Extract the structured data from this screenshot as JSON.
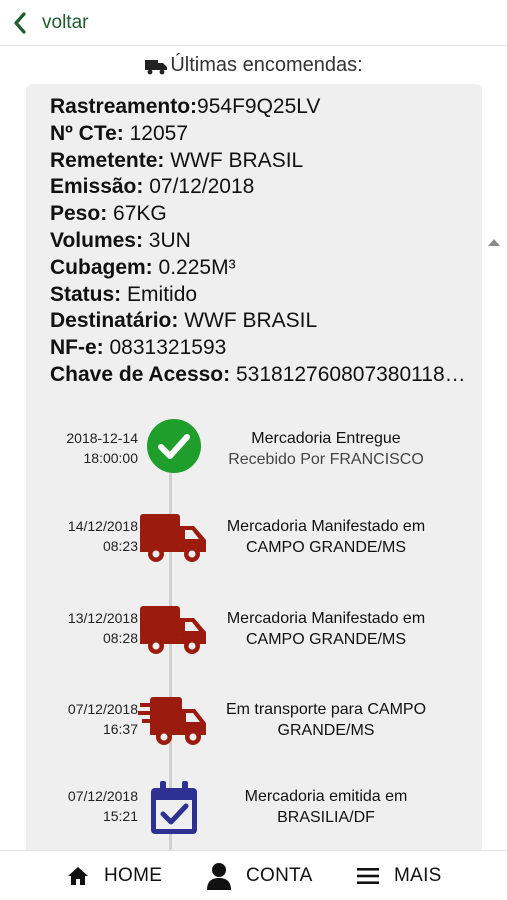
{
  "header": {
    "back_label": "voltar"
  },
  "section": {
    "title": "Últimas encomendas:"
  },
  "shipment": [
    {
      "label": "Rastreamento:",
      "value": "954F9Q25LV"
    },
    {
      "label": "Nº CTe:",
      "value": " 12057"
    },
    {
      "label": "Remetente:",
      "value": " WWF BRASIL"
    },
    {
      "label": "Emissão:",
      "value": " 07/12/2018"
    },
    {
      "label": "Peso:",
      "value": " 67KG"
    },
    {
      "label": "Volumes:",
      "value": " 3UN"
    },
    {
      "label": "Cubagem:",
      "value": " 0.225M³"
    },
    {
      "label": "Status:",
      "value": " Emitido"
    },
    {
      "label": "Destinatário:",
      "value": " WWF BRASIL"
    },
    {
      "label": "NF-e:",
      "value": " 0831321593"
    },
    {
      "label": "Chave de Acesso:",
      "value": " 5318127608073801181..."
    }
  ],
  "timeline": [
    {
      "date": "2018-12-14",
      "time": "18:00:00",
      "title": "Mercadoria Entregue",
      "subtitle": "Recebido Por FRANCISCO",
      "icon": "check-circle-icon",
      "color": "#1f9e2c"
    },
    {
      "date": "14/12/2018",
      "time": "08:23",
      "title": "Mercadoria Manifestado em CAMPO GRANDE/MS",
      "subtitle": "",
      "icon": "truck-icon",
      "color": "#9b1c0f"
    },
    {
      "date": "13/12/2018",
      "time": "08:28",
      "title": "Mercadoria Manifestado em CAMPO GRANDE/MS",
      "subtitle": "",
      "icon": "truck-icon",
      "color": "#9b1c0f"
    },
    {
      "date": "07/12/2018",
      "time": "16:37",
      "title": "Em transporte para CAMPO GRANDE/MS",
      "subtitle": "",
      "icon": "fast-truck-icon",
      "color": "#9b1c0f"
    },
    {
      "date": "07/12/2018",
      "time": "15:21",
      "title": "Mercadoria emitida em BRASILIA/DF",
      "subtitle": "",
      "icon": "calendar-check-icon",
      "color": "#2e3192"
    }
  ],
  "nav": {
    "home_label": "HOME",
    "account_label": "CONTA",
    "more_label": "MAIS"
  },
  "colors": {
    "accent_green": "#1f5c2e"
  }
}
